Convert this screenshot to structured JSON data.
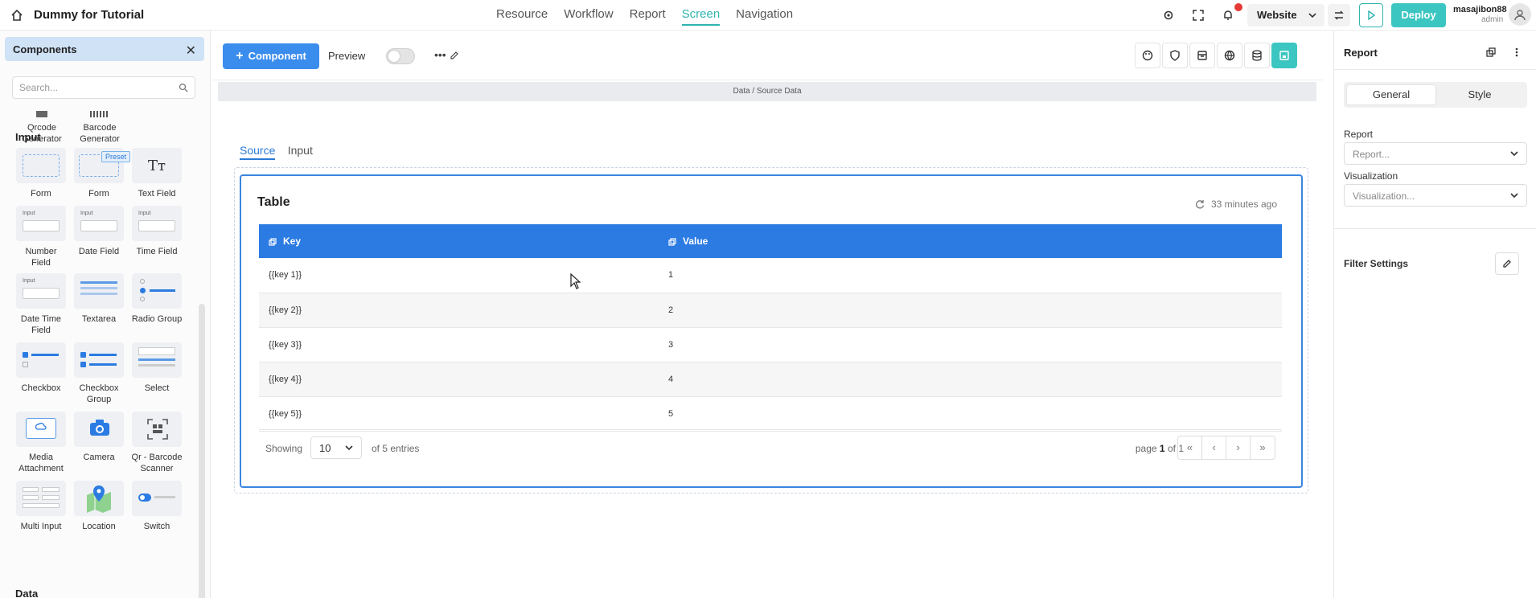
{
  "app": {
    "title": "Dummy for Tutorial"
  },
  "nav": {
    "items": [
      {
        "label": "Resource",
        "active": false
      },
      {
        "label": "Workflow",
        "active": false
      },
      {
        "label": "Report",
        "active": false
      },
      {
        "label": "Screen",
        "active": true
      },
      {
        "label": "Navigation",
        "active": false
      }
    ]
  },
  "header": {
    "website_label": "Website",
    "deploy_label": "Deploy",
    "user_name": "masajibon88",
    "user_role": "admin",
    "icons": [
      "gear-icon",
      "expand-icon",
      "bell-icon",
      "swap-icon",
      "play-icon",
      "user-icon"
    ]
  },
  "left_panel": {
    "title": "Components",
    "search_placeholder": "Search...",
    "top_items": [
      {
        "label": "Qrcode Generator",
        "icon": "qrcode-icon"
      },
      {
        "label": "Barcode Generator",
        "icon": "barcode-icon"
      }
    ],
    "sections": [
      {
        "label": "Input"
      },
      {
        "label": "Data"
      }
    ],
    "input_items": [
      {
        "label": "Form",
        "icon": "form-icon"
      },
      {
        "label": "Form",
        "icon": "form-preset-icon",
        "badge": "Preset"
      },
      {
        "label": "Text Field",
        "icon": "text-field-icon",
        "glyph": "Tт"
      },
      {
        "label": "Number Field",
        "icon": "number-field-icon",
        "hint": "Input"
      },
      {
        "label": "Date Field",
        "icon": "date-field-icon",
        "hint": "Input"
      },
      {
        "label": "Time Field",
        "icon": "time-field-icon",
        "hint": "Input"
      },
      {
        "label": "Date Time Field",
        "icon": "datetime-field-icon",
        "hint": "Input"
      },
      {
        "label": "Textarea",
        "icon": "textarea-icon"
      },
      {
        "label": "Radio Group",
        "icon": "radio-group-icon"
      },
      {
        "label": "Checkbox",
        "icon": "checkbox-icon"
      },
      {
        "label": "Checkbox Group",
        "icon": "checkbox-group-icon"
      },
      {
        "label": "Select",
        "icon": "select-icon"
      },
      {
        "label": "Media Attachment",
        "icon": "media-icon"
      },
      {
        "label": "Camera",
        "icon": "camera-icon"
      },
      {
        "label": "Qr - Barcode Scanner",
        "icon": "scanner-icon"
      },
      {
        "label": "Multi Input",
        "icon": "multi-input-icon"
      },
      {
        "label": "Location",
        "icon": "location-icon"
      },
      {
        "label": "Switch",
        "icon": "switch-icon"
      }
    ]
  },
  "toolbar": {
    "component_label": "Component",
    "preview_label": "Preview",
    "preview_on": false,
    "icons": [
      "palette-icon",
      "shield-icon",
      "archive-icon",
      "globe-icon",
      "database-icon",
      "save-icon"
    ]
  },
  "canvas": {
    "breadcrumb": "Data / Source Data",
    "tabs": [
      {
        "label": "Source",
        "active": true
      },
      {
        "label": "Input",
        "active": false
      }
    ],
    "card": {
      "title": "Table",
      "refreshed": "33 minutes ago",
      "columns": [
        "Key",
        "Value"
      ],
      "rows": [
        [
          "{{key 1}}",
          "1"
        ],
        [
          "{{key 2}}",
          "2"
        ],
        [
          "{{key 3}}",
          "3"
        ],
        [
          "{{key 4}}",
          "4"
        ],
        [
          "{{key 5}}",
          "5"
        ]
      ],
      "footer": {
        "showing": "Showing",
        "page_size": "10",
        "entries": "of 5 entries",
        "page_prefix": "page",
        "page_current": "1",
        "page_of": "of",
        "page_total": "1"
      }
    }
  },
  "right_panel": {
    "title": "Report",
    "tabs": [
      {
        "label": "General",
        "active": true
      },
      {
        "label": "Style",
        "active": false
      }
    ],
    "report_label": "Report",
    "report_placeholder": "Report...",
    "visualization_label": "Visualization",
    "visualization_placeholder": "Visualization...",
    "filter_label": "Filter Settings"
  },
  "colors": {
    "accent": "#2fb4b0",
    "primary": "#2b7be2",
    "deploy": "#3cc6c1"
  }
}
